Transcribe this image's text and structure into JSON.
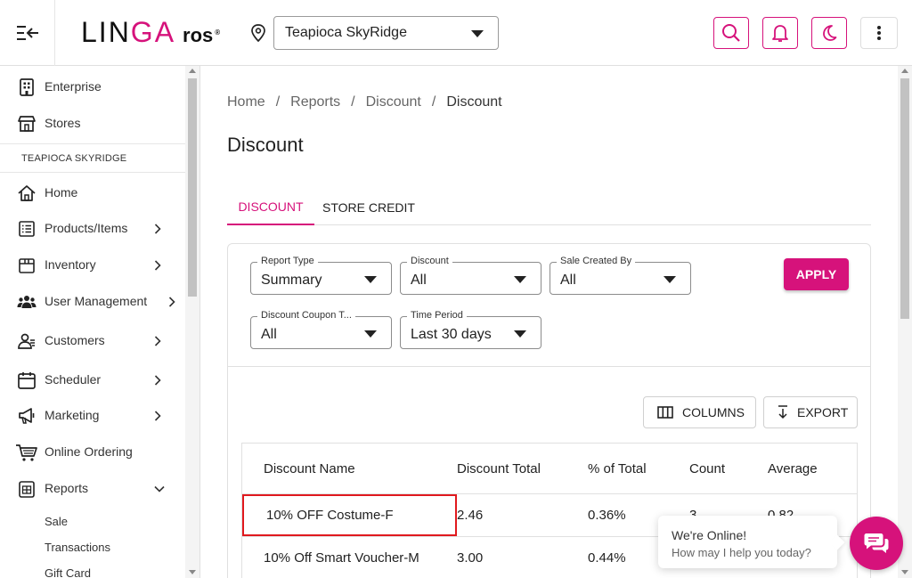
{
  "header": {
    "logo_main_a": "LIN",
    "logo_main_b": "GA",
    "logo_sub": "ros",
    "logo_reg": "®",
    "store": "Teapioca SkyRidge"
  },
  "sidebar": {
    "top_items": [
      {
        "label": "Enterprise"
      },
      {
        "label": "Stores"
      }
    ],
    "store_label": "TEAPIOCA SKYRIDGE",
    "items": [
      {
        "label": "Home"
      },
      {
        "label": "Products/Items"
      },
      {
        "label": "Inventory"
      },
      {
        "label": "User Management"
      },
      {
        "label": "Customers"
      },
      {
        "label": "Scheduler"
      },
      {
        "label": "Marketing"
      },
      {
        "label": "Online Ordering"
      },
      {
        "label": "Reports"
      }
    ],
    "report_sub": [
      {
        "label": "Sale"
      },
      {
        "label": "Transactions"
      },
      {
        "label": "Gift Card"
      }
    ]
  },
  "breadcrumb": [
    "Home",
    "Reports",
    "Discount",
    "Discount"
  ],
  "breadcrumb_sep": "/",
  "page_title": "Discount",
  "tabs": [
    {
      "label": "DISCOUNT",
      "active": true
    },
    {
      "label": "STORE CREDIT",
      "active": false
    }
  ],
  "filters": [
    {
      "label": "Report Type",
      "value": "Summary"
    },
    {
      "label": "Discount",
      "value": "All"
    },
    {
      "label": "Sale Created By",
      "value": "All"
    },
    {
      "label": "Discount Coupon T...",
      "value": "All"
    },
    {
      "label": "Time Period",
      "value": "Last 30 days"
    }
  ],
  "apply_label": "APPLY",
  "columns_label": "COLUMNS",
  "export_label": "EXPORT",
  "table": {
    "headers": [
      "Discount Name",
      "Discount Total",
      "% of Total",
      "Count",
      "Average"
    ],
    "rows": [
      [
        "10% OFF Costume-F",
        "2.46",
        "0.36%",
        "3",
        "0.82"
      ],
      [
        "10% Off Smart Voucher-M",
        "3.00",
        "0.44%",
        "",
        ""
      ]
    ]
  },
  "chat": {
    "title": "We're Online!",
    "subtitle": "How may I help you today?"
  },
  "colors": {
    "brand": "#d6127b",
    "highlight": "#e0191e"
  }
}
